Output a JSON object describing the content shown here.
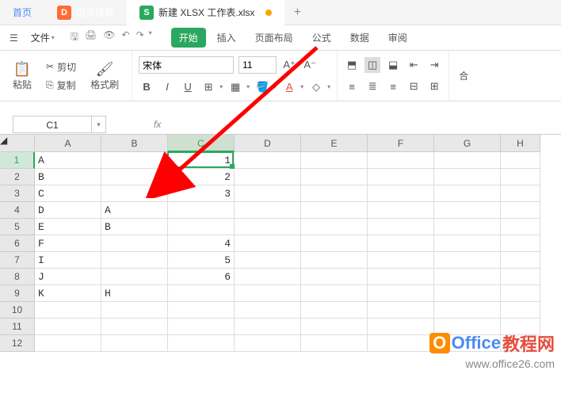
{
  "tabs": {
    "home": "首页",
    "docer": "稻壳模板",
    "docer_icon": "D",
    "active_icon": "S",
    "active_label": "新建 XLSX 工作表.xlsx",
    "add": "+"
  },
  "menubar": {
    "file": "文件",
    "ribbon": [
      "开始",
      "插入",
      "页面布局",
      "公式",
      "数据",
      "审阅"
    ]
  },
  "toolbar": {
    "paste": "粘贴",
    "cut": "剪切",
    "copy": "复制",
    "format_painter": "格式刷",
    "font": "宋体",
    "size": "11",
    "merge": "合"
  },
  "name_box": "C1",
  "fx_label": "fx",
  "columns": [
    "A",
    "B",
    "C",
    "D",
    "E",
    "F",
    "G",
    "H"
  ],
  "rows": [
    "1",
    "2",
    "3",
    "4",
    "5",
    "6",
    "7",
    "8",
    "9",
    "10",
    "11",
    "12"
  ],
  "chart_data": {
    "type": "table",
    "columns": [
      "A",
      "B",
      "C"
    ],
    "data": [
      {
        "A": "A",
        "B": "",
        "C": 1
      },
      {
        "A": "B",
        "B": "",
        "C": 2
      },
      {
        "A": "C",
        "B": "",
        "C": 3
      },
      {
        "A": "D",
        "B": "A",
        "C": ""
      },
      {
        "A": "E",
        "B": "B",
        "C": ""
      },
      {
        "A": "F",
        "B": "",
        "C": 4
      },
      {
        "A": "I",
        "B": "",
        "C": 5
      },
      {
        "A": "J",
        "B": "",
        "C": 6
      },
      {
        "A": "K",
        "B": "H",
        "C": ""
      }
    ]
  },
  "watermark": {
    "o": "O",
    "blue": "Office",
    "red": "教程网",
    "url": "www.office26.com"
  }
}
